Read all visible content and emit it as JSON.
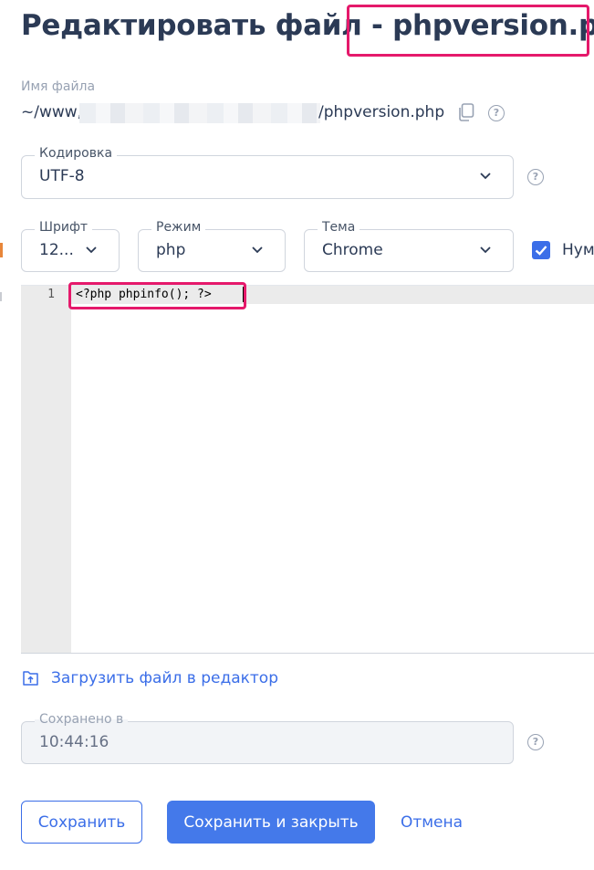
{
  "header": {
    "title_prefix": "Редактировать файл - ",
    "title_filename": "phpversion.php"
  },
  "file_name": {
    "label": "Имя файла",
    "path_prefix": "~/www,",
    "path_suffix": "/phpversion.php",
    "copy_icon": "copy-icon",
    "help_icon": "?"
  },
  "encoding": {
    "legend": "Кодировка",
    "value": "UTF-8",
    "help_icon": "?"
  },
  "font": {
    "legend": "Шрифт",
    "value": "12..."
  },
  "mode": {
    "legend": "Режим",
    "value": "php"
  },
  "theme": {
    "legend": "Тема",
    "value": "Chrome"
  },
  "line_numbers": {
    "label": "Нум",
    "checked": true
  },
  "editor": {
    "lines": [
      {
        "number": "1",
        "code": "<?php phpinfo(); ?>"
      }
    ]
  },
  "upload": {
    "label": "Загрузить файл в редактор",
    "icon": "upload-icon"
  },
  "saved": {
    "legend": "Сохранено в",
    "value": "10:44:16",
    "help_icon": "?"
  },
  "actions": {
    "save": "Сохранить",
    "save_close": "Сохранить и закрыть",
    "cancel": "Отмена"
  },
  "colors": {
    "accent": "#3b6ee8",
    "highlight": "#e5196b",
    "title": "#2b3a55"
  }
}
